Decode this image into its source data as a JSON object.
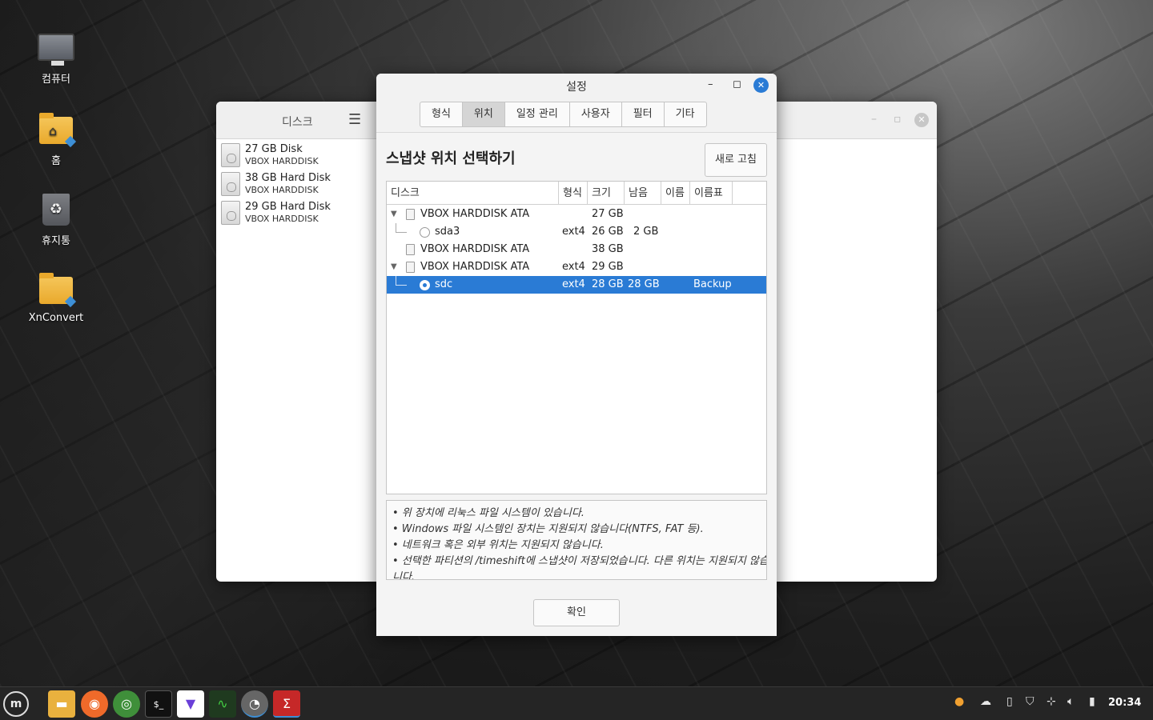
{
  "desktop": {
    "icons": [
      {
        "label": "컴퓨터",
        "icon": "computer-icon"
      },
      {
        "label": "홈",
        "icon": "home-folder-icon"
      },
      {
        "label": "휴지통",
        "icon": "trash-icon"
      },
      {
        "label": "XnConvert",
        "icon": "folder-icon"
      }
    ]
  },
  "disks_window": {
    "title": "디스크",
    "items": [
      {
        "name": "27 GB Disk",
        "model": "VBOX HARDDISK"
      },
      {
        "name": "38 GB Hard Disk",
        "model": "VBOX HARDDISK"
      },
      {
        "name": "29 GB Hard Disk",
        "model": "VBOX HARDDISK"
      }
    ]
  },
  "settings": {
    "title": "설정",
    "tabs": [
      "형식",
      "위치",
      "일정 관리",
      "사용자",
      "필터",
      "기타"
    ],
    "active_tab": "위치",
    "section_title": "스냅샷 위치 선택하기",
    "refresh_label": "새로 고침",
    "columns": [
      "디스크",
      "형식",
      "크기",
      "남음",
      "이름",
      "이름표"
    ],
    "rows": [
      {
        "name": "VBOX HARDDISK ATA",
        "type": "",
        "size": "27 GB",
        "free": "",
        "label": ""
      },
      {
        "name": "sda3",
        "type": "ext4",
        "size": "26 GB",
        "free": "2 GB",
        "label": ""
      },
      {
        "name": "VBOX HARDDISK ATA",
        "type": "",
        "size": "38 GB",
        "free": "",
        "label": ""
      },
      {
        "name": "VBOX HARDDISK ATA",
        "type": "ext4",
        "size": "29 GB",
        "free": "",
        "label": ""
      },
      {
        "name": "sdc",
        "type": "ext4",
        "size": "28 GB",
        "free": "28 GB",
        "label": "Backup"
      }
    ],
    "notes": [
      "• 위 장치에 리눅스 파일 시스템이 있습니다.",
      "• Windows 파일 시스템인 장치는 지원되지 않습니다(NTFS, FAT 등).",
      "• 네트워크 혹은 외부 위치는 지원되지 않습니다.",
      "• 선택한 파티션의 /timeshift에 스냅샷이 저장되었습니다. 다른 위치는 지원되지 않습",
      "니다."
    ],
    "ok_label": "확인"
  },
  "taskbar": {
    "apps": [
      "files-icon",
      "firefox-icon",
      "chrome-icon",
      "terminal-icon",
      "vpn-icon",
      "system-monitor-icon",
      "disks-icon",
      "timeshift-icon"
    ],
    "clock": "20:34"
  },
  "colors": {
    "accent": "#2a7bd5",
    "taskbar": "#252525"
  }
}
